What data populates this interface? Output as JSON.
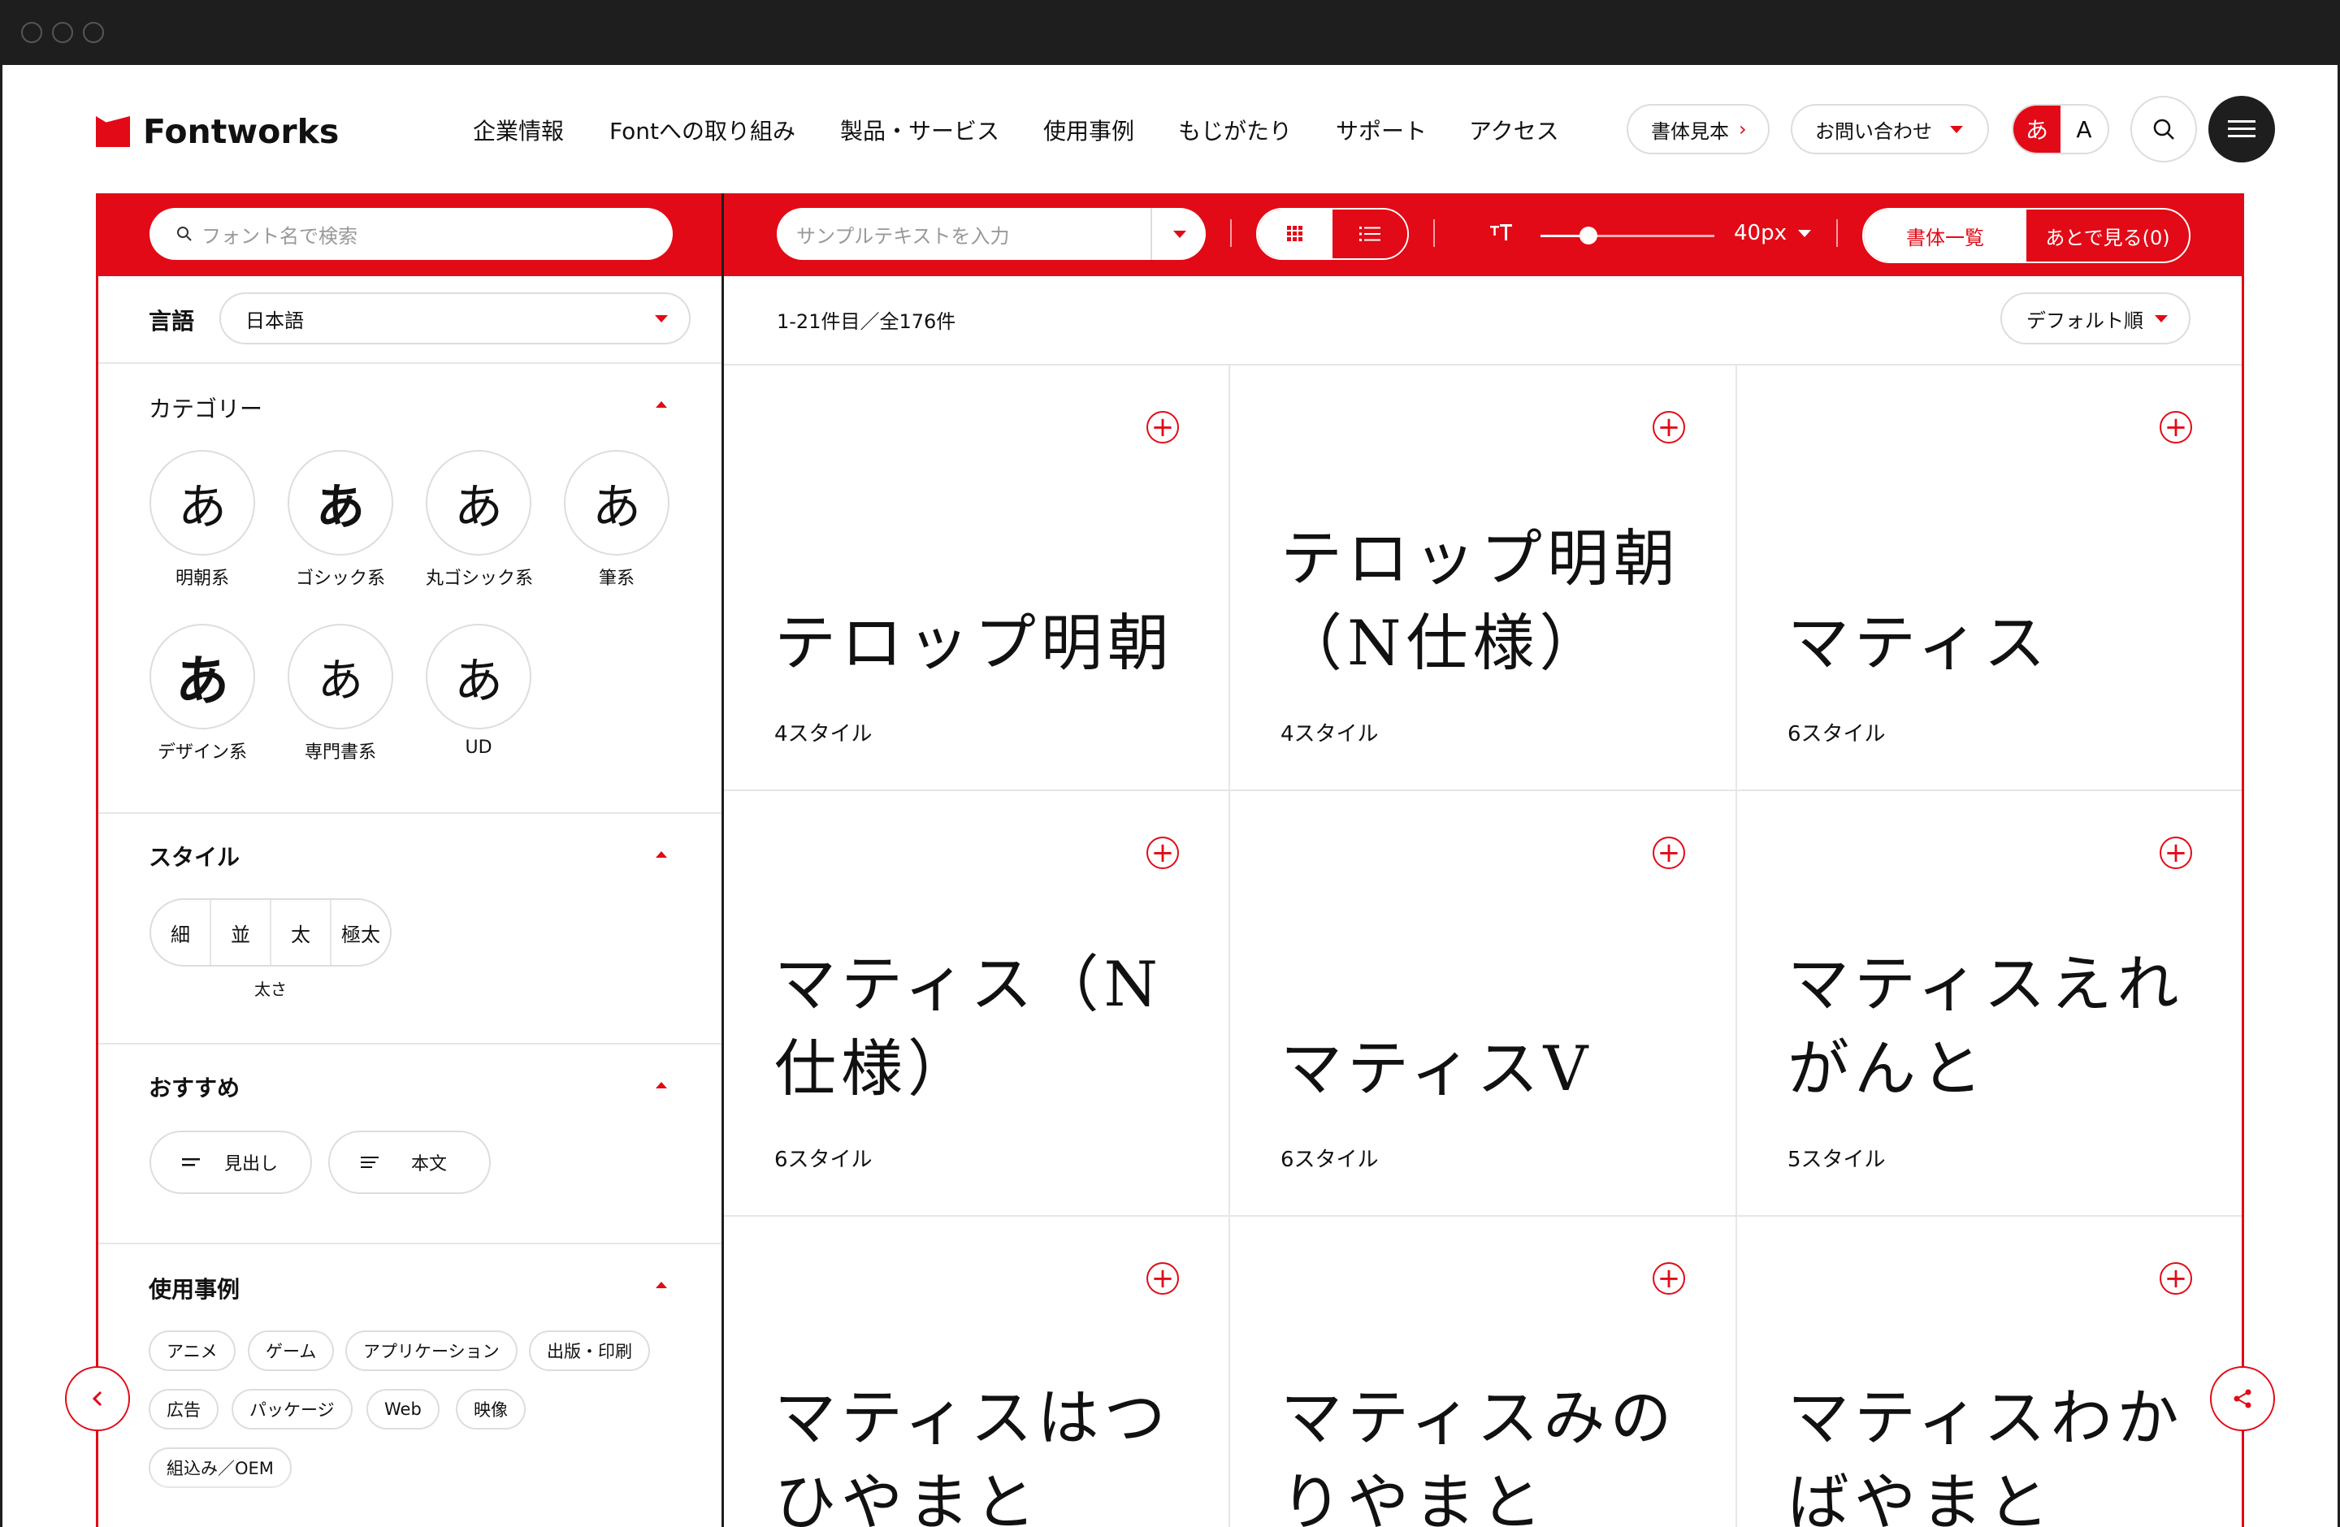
{
  "header": {
    "logo_text": "Fontworks",
    "nav": [
      "企業情報",
      "Fontへの取り組み",
      "製品・サービス",
      "使用事例",
      "もじがたり",
      "サポート",
      "アクセス"
    ],
    "sample_book": "書体見本",
    "contact": "お問い合わせ",
    "lang_ja": "あ",
    "lang_en": "A"
  },
  "toolbar": {
    "font_search_placeholder": "フォント名で検索",
    "sample_text_placeholder": "サンプルテキストを入力",
    "size_label": "40px",
    "tab_list": "書体一覧",
    "tab_later": "あとで見る(0)"
  },
  "sidebar": {
    "language_label": "言語",
    "language_value": "日本語",
    "category_label": "カテゴリー",
    "categories": [
      {
        "glyph": "あ",
        "label": "明朝系"
      },
      {
        "glyph": "あ",
        "label": "ゴシック系"
      },
      {
        "glyph": "あ",
        "label": "丸ゴシック系"
      },
      {
        "glyph": "あ",
        "label": "筆系"
      },
      {
        "glyph": "あ",
        "label": "デザイン系"
      },
      {
        "glyph": "あ",
        "label": "専門書系"
      },
      {
        "glyph": "あ",
        "label": "UD"
      }
    ],
    "style_label": "スタイル",
    "weights": [
      "細",
      "並",
      "太",
      "極太"
    ],
    "weight_caption": "太さ",
    "recommend_label": "おすすめ",
    "recommend": [
      "見出し",
      "本文"
    ],
    "usecase_label": "使用事例",
    "usecases": [
      "アニメ",
      "ゲーム",
      "アプリケーション",
      "出版・印刷",
      "広告",
      "パッケージ",
      "Web",
      "映像",
      "組込み／OEM"
    ]
  },
  "main": {
    "count_text": "1-21件目／全176件",
    "sort_label": "デフォルト順",
    "fonts": [
      {
        "name": "テロップ明朝",
        "styles": "4スタイル"
      },
      {
        "name": "テロップ明朝\n（N仕様）",
        "styles": "4スタイル"
      },
      {
        "name": "マティス",
        "styles": "6スタイル"
      },
      {
        "name": "マティス（N\n仕様）",
        "styles": "6スタイル"
      },
      {
        "name": "マティスV",
        "styles": "6スタイル"
      },
      {
        "name": "マティスえれ\nがんと",
        "styles": "5スタイル"
      },
      {
        "name": "マティスはつ\nひやまと",
        "styles": ""
      },
      {
        "name": "マティスみの\nりやまと",
        "styles": ""
      },
      {
        "name": "マティスわか\nばやまと",
        "styles": ""
      }
    ]
  },
  "colors": {
    "accent": "#e20a16",
    "chrome": "#1e1e1e"
  }
}
